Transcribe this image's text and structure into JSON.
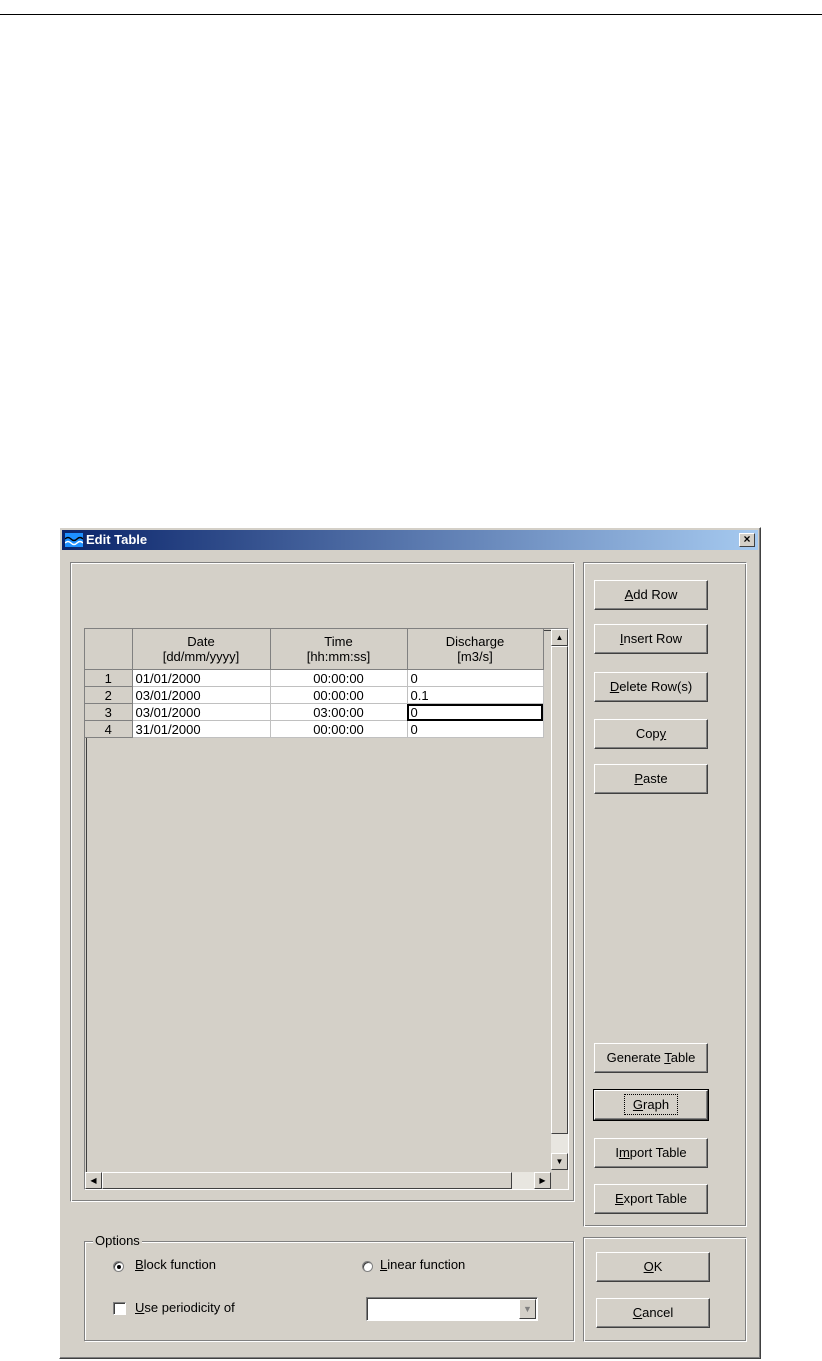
{
  "dialog": {
    "title": "Edit Table",
    "close_glyph": "×"
  },
  "table": {
    "columns": [
      {
        "line1": "Date",
        "line2": "[dd/mm/yyyy]"
      },
      {
        "line1": "Time",
        "line2": "[hh:mm:ss]"
      },
      {
        "line1": "Discharge",
        "line2": "[m3/s]"
      }
    ],
    "rows": [
      {
        "num": "1",
        "date": "01/01/2000",
        "time": "00:00:00",
        "discharge": "0"
      },
      {
        "num": "2",
        "date": "03/01/2000",
        "time": "00:00:00",
        "discharge": "0.1"
      },
      {
        "num": "3",
        "date": "03/01/2000",
        "time": "03:00:00",
        "discharge": "0"
      },
      {
        "num": "4",
        "date": "31/01/2000",
        "time": "00:00:00",
        "discharge": "0"
      }
    ]
  },
  "buttons": {
    "add_row": {
      "mn": "A",
      "rest": "dd Row"
    },
    "insert_row": {
      "mn": "I",
      "rest": "nsert Row"
    },
    "delete_rows": {
      "mn": "D",
      "rest": "elete Row(s)"
    },
    "copy": {
      "pre": "Cop",
      "mn": "y"
    },
    "paste": {
      "mn": "P",
      "rest": "aste"
    },
    "generate_table": {
      "pre": "Generate ",
      "mn": "T",
      "rest": "able"
    },
    "graph": {
      "mn": "G",
      "rest": "raph"
    },
    "import_table": {
      "pre": "I",
      "mn": "m",
      "rest": "port Table"
    },
    "export_table": {
      "mn": "E",
      "rest": "xport Table"
    },
    "ok": {
      "mn": "O",
      "rest": "K"
    },
    "cancel": {
      "mn": "C",
      "rest": "ancel"
    }
  },
  "options": {
    "group_label": "Options",
    "block_function": {
      "mn": "B",
      "rest": "lock function",
      "selected": true
    },
    "linear_function": {
      "mn": "L",
      "rest": "inear function",
      "selected": false
    },
    "use_periodicity": {
      "mn": "U",
      "rest": "se periodicity of",
      "checked": false
    },
    "periodicity_value": ""
  },
  "icons": {
    "app": "app-wave-icon",
    "close": "close-icon",
    "up": "scroll-up-icon",
    "down": "scroll-down-icon",
    "left": "scroll-left-icon",
    "right": "scroll-right-icon",
    "dropdown": "chevron-down-icon"
  },
  "colors": {
    "title_start": "#0a246a",
    "title_end": "#a6caf0",
    "face": "#d4d0c8"
  }
}
